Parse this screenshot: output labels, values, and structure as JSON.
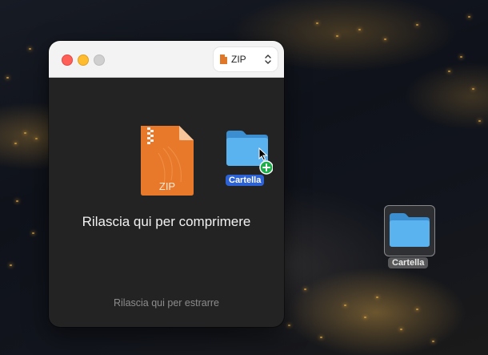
{
  "window": {
    "format_selector": {
      "value": "ZIP"
    },
    "drop_compress_text": "Rilascia qui per comprimere",
    "drop_extract_text": "Rilascia qui per estrarre",
    "zip_file_icon": {
      "icon": "zip-file-icon",
      "label": "ZIP"
    },
    "dragged_item": {
      "icon": "folder-icon",
      "label": "Cartella",
      "badge": "add-plus-icon"
    }
  },
  "desktop": {
    "folder": {
      "icon": "folder-icon",
      "label": "Cartella"
    }
  },
  "colors": {
    "zip_orange": "#e8792b",
    "folder_blue": "#4aa8e8",
    "selection_blue": "#2c62d3",
    "badge_green": "#1fae4b"
  }
}
